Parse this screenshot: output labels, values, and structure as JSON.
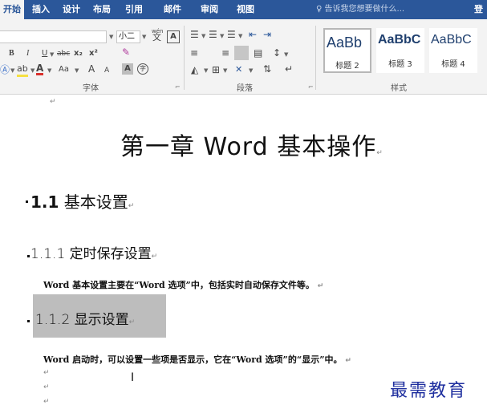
{
  "tabs": [
    "开始",
    "插入",
    "设计",
    "布局",
    "引用",
    "邮件",
    "审阅",
    "视图"
  ],
  "tell_me": "告诉我您想要做什么...",
  "sign_in": "登",
  "font": {
    "size_value": "小二",
    "wen_label": "wén",
    "wen_char": "文",
    "boxed_A": "A",
    "bold": "B",
    "italic": "I",
    "underline": "U",
    "strike": "abc",
    "subscript": "x₂",
    "superscript": "x²",
    "case_label": "Aa",
    "grow_font": "A",
    "shrink_font": "A",
    "enclose_char": "字",
    "group_label": "字体"
  },
  "paragraph": {
    "group_label": "段落"
  },
  "styles": {
    "items": [
      {
        "sample": "AaBb",
        "name": "标题 2"
      },
      {
        "sample": "AaBbC",
        "name": "标题 3"
      },
      {
        "sample": "AaBbC",
        "name": "标题 4"
      }
    ],
    "group_label": "样式"
  },
  "document": {
    "title_cn1": "第一章",
    "title_en": "Word",
    "title_cn2": "基本操作",
    "h1_num": "1.1",
    "h1_text": "基本设置",
    "h2a_num": "1.1.1",
    "h2a_text": "定时保存设置",
    "para1": "Word 基本设置主要在“Word 选项”中，包括实时自动保存文件等。",
    "h2b_num": "1.1.2",
    "h2b_text": "显示设置",
    "para2": "Word 启动时，可以设置一些项是否显示，它在“Word 选项”的“显示”中。",
    "pilcrow": "↵"
  },
  "watermark": "最需教育",
  "colors": {
    "ribbon_tab_bg": "#2b579a",
    "ribbon_bg": "#f3f3f3",
    "selection": "#bdbdbd",
    "watermark": "#1f2f9f"
  }
}
